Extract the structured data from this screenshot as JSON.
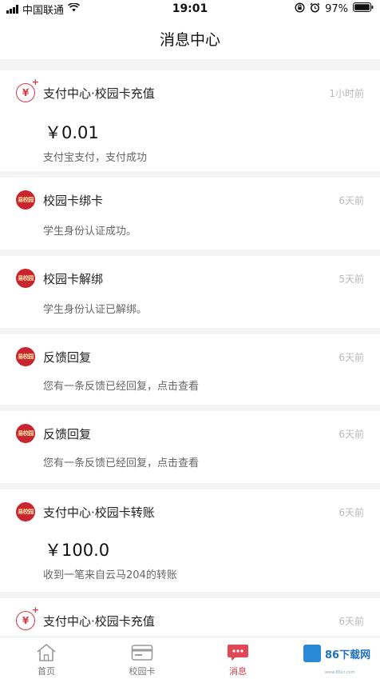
{
  "status_bar": {
    "carrier": "中国联通",
    "time": "19:01",
    "battery": "97%"
  },
  "header": {
    "title": "消息中心"
  },
  "messages": [
    {
      "icon": "payment-icon",
      "title": "支付中心·校园卡充值",
      "time": "1小时前",
      "amount": "￥0.01",
      "desc": "支付宝支付，支付成功"
    },
    {
      "icon": "campus-logo-icon",
      "logo_text": "易校园",
      "title": "校园卡绑卡",
      "time": "6天前",
      "desc": "学生身份认证成功。"
    },
    {
      "icon": "campus-logo-icon",
      "logo_text": "易校园",
      "title": "校园卡解绑",
      "time": "5天前",
      "desc": "学生身份认证已解绑。"
    },
    {
      "icon": "campus-logo-icon",
      "logo_text": "易校园",
      "title": "反馈回复",
      "time": "6天前",
      "desc": "您有一条反馈已经回复，点击查看"
    },
    {
      "icon": "campus-logo-icon",
      "logo_text": "易校园",
      "title": "反馈回复",
      "time": "6天前",
      "desc": "您有一条反馈已经回复，点击查看"
    },
    {
      "icon": "campus-logo-icon",
      "logo_text": "易校园",
      "title": "支付中心·校园卡转账",
      "time": "6天前",
      "amount": "￥100.0",
      "desc": "收到一笔来自云马204的转账"
    },
    {
      "icon": "payment-icon",
      "title": "支付中心·校园卡充值",
      "time": "6天前"
    }
  ],
  "tabbar": {
    "items": [
      {
        "label": "首页",
        "icon": "home-icon"
      },
      {
        "label": "校园卡",
        "icon": "card-icon"
      },
      {
        "label": "消息",
        "icon": "message-icon",
        "active": true
      }
    ]
  },
  "watermark": {
    "text": "86下载网",
    "sub": "www.86xz.com"
  },
  "colors": {
    "accent": "#d63b4a",
    "background": "#f4f4f5"
  }
}
